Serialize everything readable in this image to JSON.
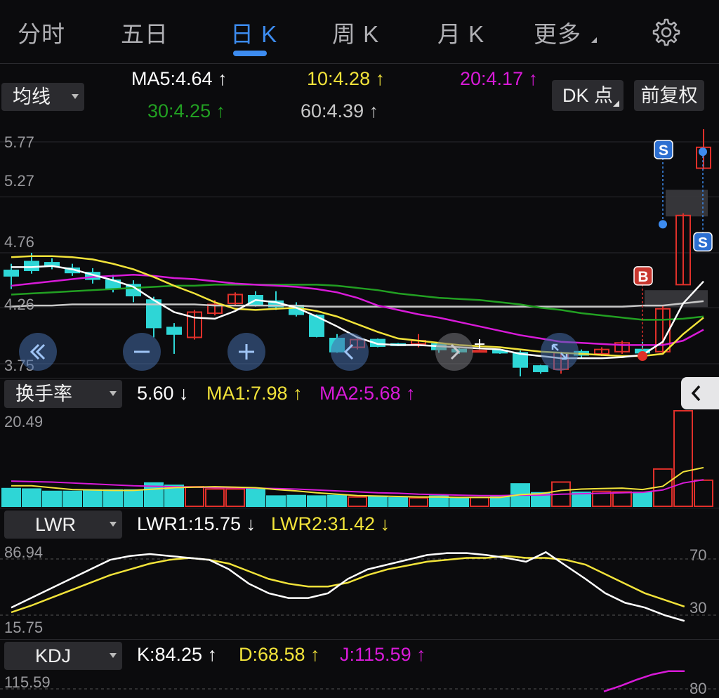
{
  "tabs": [
    {
      "label": "分时"
    },
    {
      "label": "五日"
    },
    {
      "label": "日 K"
    },
    {
      "label": "周 K"
    },
    {
      "label": "月 K"
    },
    {
      "label": "更多"
    }
  ],
  "active_tab": "日 K",
  "ma_panel": {
    "selector": "均线",
    "ma5": "MA5:4.64 ↑",
    "ma10": "10:4.28 ↑",
    "ma20": "20:4.17 ↑",
    "ma30": "30:4.25 ↑",
    "ma60": "60:4.39 ↑",
    "dk_button": "DK 点",
    "fq_button": "前复权"
  },
  "price_axis": [
    "5.77",
    "5.27",
    "4.76",
    "4.26",
    "3.75"
  ],
  "markers": {
    "buy": "B",
    "sell": "S"
  },
  "turnover_panel": {
    "selector": "换手率",
    "value": "5.60 ↓",
    "ma1": "MA1:7.98 ↑",
    "ma2": "MA2:5.68 ↑",
    "axis_top": "20.49"
  },
  "lwr_panel": {
    "selector": "LWR",
    "lwr1": "LWR1:15.75 ↓",
    "lwr2": "LWR2:31.42 ↓",
    "axis_top": "86.94",
    "axis_bottom": "15.75",
    "right_top": "70",
    "right_bottom": "30"
  },
  "kdj_panel": {
    "selector": "KDJ",
    "k": "K:84.25 ↑",
    "d": "D:68.58 ↑",
    "j": "J:115.59 ↑",
    "axis_top": "115.59",
    "right_top": "80"
  },
  "colors": {
    "up": "#e0302a",
    "down": "#2ed6d6",
    "ma5": "#ffffff",
    "ma10": "#f2e33a",
    "ma20": "#d81ad8",
    "ma30": "#22a022",
    "ma60": "#c8c8c8",
    "accent": "#3d8cf0"
  },
  "chart_data": {
    "type": "candlestick",
    "ylim": [
      3.75,
      5.77
    ],
    "candles": [
      {
        "o": 4.6,
        "c": 4.55,
        "h": 4.66,
        "l": 4.43
      },
      {
        "o": 4.68,
        "c": 4.6,
        "h": 4.76,
        "l": 4.57
      },
      {
        "o": 4.67,
        "c": 4.64,
        "h": 4.71,
        "l": 4.61
      },
      {
        "o": 4.62,
        "c": 4.58,
        "h": 4.66,
        "l": 4.55
      },
      {
        "o": 4.58,
        "c": 4.52,
        "h": 4.62,
        "l": 4.48
      },
      {
        "o": 4.51,
        "c": 4.44,
        "h": 4.56,
        "l": 4.4
      },
      {
        "o": 4.47,
        "c": 4.37,
        "h": 4.51,
        "l": 4.31
      },
      {
        "o": 4.33,
        "c": 4.08,
        "h": 4.36,
        "l": 3.99
      },
      {
        "o": 4.08,
        "c": 4.02,
        "h": 4.12,
        "l": 3.84
      },
      {
        "o": 3.99,
        "c": 4.22,
        "h": 4.24,
        "l": 3.97
      },
      {
        "o": 4.21,
        "c": 4.29,
        "h": 4.33,
        "l": 4.19
      },
      {
        "o": 4.3,
        "c": 4.38,
        "h": 4.4,
        "l": 4.28
      },
      {
        "o": 4.37,
        "c": 4.29,
        "h": 4.41,
        "l": 4.27
      },
      {
        "o": 4.32,
        "c": 4.27,
        "h": 4.41,
        "l": 4.24
      },
      {
        "o": 4.28,
        "c": 4.2,
        "h": 4.31,
        "l": 4.18
      },
      {
        "o": 4.19,
        "c": 4.0,
        "h": 4.2,
        "l": 3.99
      },
      {
        "o": 3.98,
        "c": 3.86,
        "h": 4.02,
        "l": 3.85
      },
      {
        "o": 3.9,
        "c": 3.97,
        "h": 3.98,
        "l": 3.88
      },
      {
        "o": 3.97,
        "c": 3.91,
        "h": 3.98,
        "l": 3.9
      },
      {
        "o": 3.93,
        "c": 3.92,
        "h": 3.94,
        "l": 3.91
      },
      {
        "o": 3.93,
        "c": 3.96,
        "h": 4.02,
        "l": 3.9
      },
      {
        "o": 3.93,
        "c": 3.88,
        "h": 3.94,
        "l": 3.85
      },
      {
        "o": 3.88,
        "c": 3.86,
        "h": 3.89,
        "l": 3.84
      },
      {
        "o": 3.87,
        "c": 3.87,
        "h": 3.88,
        "l": 3.86
      },
      {
        "o": 3.87,
        "c": 3.85,
        "h": 3.88,
        "l": 3.84
      },
      {
        "o": 3.85,
        "c": 3.72,
        "h": 3.87,
        "l": 3.62
      },
      {
        "o": 3.73,
        "c": 3.68,
        "h": 3.74,
        "l": 3.66
      },
      {
        "o": 3.7,
        "c": 3.85,
        "h": 3.86,
        "l": 3.66
      },
      {
        "o": 3.86,
        "c": 3.83,
        "h": 3.88,
        "l": 3.8
      },
      {
        "o": 3.84,
        "c": 3.88,
        "h": 3.9,
        "l": 3.82
      },
      {
        "o": 3.86,
        "c": 3.94,
        "h": 3.96,
        "l": 3.84
      },
      {
        "o": 3.88,
        "c": 3.85,
        "h": 3.95,
        "l": 3.84
      },
      {
        "o": 3.86,
        "c": 4.25,
        "h": 4.28,
        "l": 3.84
      },
      {
        "o": 4.47,
        "c": 5.1,
        "h": 5.12,
        "l": 4.47
      },
      {
        "o": 5.53,
        "c": 5.72,
        "h": 5.89,
        "l": 5.52
      }
    ],
    "ma5": [
      4.63,
      4.63,
      4.64,
      4.61,
      4.56,
      4.51,
      4.45,
      4.33,
      4.22,
      4.17,
      4.16,
      4.23,
      4.33,
      4.31,
      4.26,
      4.18,
      4.09,
      3.99,
      3.93,
      3.92,
      3.92,
      3.91,
      3.9,
      3.89,
      3.88,
      3.84,
      3.82,
      3.8,
      3.8,
      3.8,
      3.81,
      3.83,
      3.95,
      4.3,
      4.5
    ],
    "ma10": [
      4.72,
      4.73,
      4.73,
      4.72,
      4.7,
      4.66,
      4.61,
      4.54,
      4.46,
      4.39,
      4.31,
      4.25,
      4.24,
      4.25,
      4.26,
      4.23,
      4.18,
      4.11,
      4.04,
      3.98,
      3.96,
      3.94,
      3.92,
      3.91,
      3.9,
      3.88,
      3.86,
      3.85,
      3.84,
      3.83,
      3.82,
      3.82,
      3.84,
      4.02,
      4.17
    ],
    "ma20": [
      4.46,
      4.48,
      4.5,
      4.52,
      4.54,
      4.55,
      4.56,
      4.55,
      4.53,
      4.52,
      4.5,
      4.48,
      4.47,
      4.46,
      4.45,
      4.43,
      4.4,
      4.35,
      4.28,
      4.24,
      4.2,
      4.17,
      4.13,
      4.09,
      4.05,
      4.01,
      3.98,
      3.95,
      3.94,
      3.93,
      3.92,
      3.92,
      3.92,
      3.96,
      4.06
    ],
    "ma30": [
      4.38,
      4.39,
      4.4,
      4.41,
      4.42,
      4.43,
      4.44,
      4.45,
      4.46,
      4.46,
      4.47,
      4.47,
      4.47,
      4.47,
      4.47,
      4.47,
      4.46,
      4.44,
      4.42,
      4.39,
      4.37,
      4.35,
      4.34,
      4.33,
      4.31,
      4.29,
      4.26,
      4.24,
      4.21,
      4.19,
      4.17,
      4.15,
      4.15,
      4.16,
      4.18
    ],
    "ma60": [
      4.27,
      4.28,
      4.28,
      4.29,
      4.29,
      4.29,
      4.29,
      4.29,
      4.29,
      4.29,
      4.28,
      4.28,
      4.28,
      4.28,
      4.28,
      4.27,
      4.27,
      4.27,
      4.27,
      4.27,
      4.27,
      4.27,
      4.27,
      4.27,
      4.27,
      4.27,
      4.27,
      4.27,
      4.27,
      4.27,
      4.27,
      4.28,
      4.28,
      4.3,
      4.32
    ],
    "turnover": {
      "ylim": [
        0,
        20.49
      ],
      "values": [
        3.8,
        3.7,
        3.2,
        3.2,
        3.5,
        3.5,
        3.5,
        5.0,
        4.5,
        4.2,
        3.7,
        3.7,
        3.7,
        2.2,
        2.3,
        2.2,
        2.3,
        2.0,
        2.1,
        1.8,
        1.8,
        2.2,
        1.7,
        1.9,
        2.0,
        4.8,
        2.9,
        5.2,
        3.0,
        3.2,
        3.1,
        3.0,
        8.0,
        20.49,
        5.6
      ],
      "ma1": [
        4.4,
        4.4,
        4.0,
        3.6,
        3.5,
        3.4,
        3.4,
        3.7,
        4.0,
        4.1,
        4.2,
        4.1,
        4.0,
        3.6,
        3.3,
        2.9,
        2.6,
        2.3,
        2.2,
        2.1,
        2.0,
        2.0,
        1.9,
        1.9,
        1.9,
        2.5,
        2.7,
        3.4,
        3.7,
        3.8,
        3.9,
        3.6,
        4.3,
        7.4,
        8.3
      ],
      "ma2": [
        5.4,
        5.3,
        5.2,
        5.0,
        4.8,
        4.6,
        4.4,
        4.3,
        4.2,
        4.1,
        4.0,
        4.0,
        3.9,
        3.8,
        3.7,
        3.5,
        3.3,
        3.1,
        2.9,
        2.8,
        2.6,
        2.5,
        2.4,
        2.3,
        2.3,
        2.4,
        2.4,
        2.6,
        2.7,
        2.8,
        2.9,
        3.0,
        3.5,
        5.0,
        5.7
      ]
    },
    "lwr": {
      "ylim": [
        0,
        100
      ],
      "lwr1": [
        30,
        40,
        50,
        60,
        70,
        80,
        84,
        86,
        84,
        82,
        80,
        70,
        55,
        45,
        40,
        40,
        45,
        60,
        70,
        75,
        80,
        85,
        87,
        87,
        85,
        82,
        78,
        88,
        74,
        60,
        45,
        35,
        30,
        22,
        16
      ],
      "lwr2": [
        25,
        32,
        40,
        48,
        56,
        64,
        70,
        76,
        80,
        82,
        80,
        76,
        68,
        60,
        55,
        52,
        52,
        56,
        64,
        70,
        74,
        78,
        80,
        82,
        82,
        84,
        82,
        82,
        80,
        75,
        65,
        55,
        45,
        38,
        31
      ]
    },
    "kdj": {
      "j_tail": [
        70,
        82,
        96,
        108,
        115.59,
        115.59
      ]
    }
  }
}
